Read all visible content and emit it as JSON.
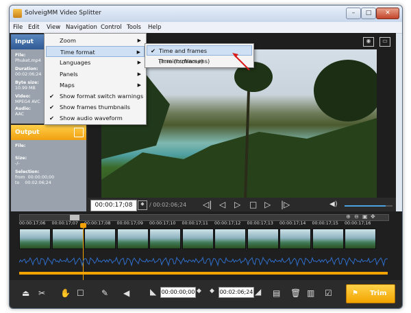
{
  "window": {
    "title": "SolveigMM Video Splitter"
  },
  "menubar": {
    "items": [
      "File",
      "Edit",
      "View",
      "Navigation",
      "Control",
      "Tools",
      "Help"
    ]
  },
  "view_menu": {
    "items": [
      {
        "label": "Zoom",
        "arrow": true,
        "checked": false
      },
      {
        "label": "Time format",
        "arrow": true,
        "checked": false
      },
      {
        "label": "Languages",
        "arrow": true,
        "checked": false
      },
      {
        "label": "Panels",
        "arrow": true,
        "checked": false
      },
      {
        "label": "Maps",
        "arrow": true,
        "checked": false
      },
      {
        "label": "Show format switch warnings",
        "arrow": false,
        "checked": true
      },
      {
        "label": "Show frames thumbnails",
        "arrow": false,
        "checked": true
      },
      {
        "label": "Show audio waveform",
        "arrow": false,
        "checked": true
      }
    ]
  },
  "time_format_submenu": {
    "items": [
      {
        "label": "Time and frames (h:min:s;frame)",
        "checked": true
      },
      {
        "label": "Time (h:min:s,ms)",
        "checked": false
      }
    ]
  },
  "input_panel": {
    "title": "Input",
    "file_label": "File:",
    "file_value": "Phuket.mp4",
    "duration_label": "Duration:",
    "duration_value": "00:02:06;24",
    "bytesize_label": "Byte size:",
    "bytesize_value": "10.99 MB",
    "video_label": "Video:",
    "video_value": "MPEG4 AVC",
    "audio_label": "Audio:",
    "audio_value": "AAC"
  },
  "output_panel": {
    "title": "Output",
    "file_label": "File:",
    "size_label": "Size:",
    "size_value": "-/-",
    "selection_label": "Selection:",
    "from_label": "from",
    "from_value": "00:00:00;00",
    "to_label": "to",
    "to_value": "00:02:06;24"
  },
  "player": {
    "current_time": "00:00:17;08",
    "total_time": "/ 00:02:06;24",
    "volume_level": 0.85
  },
  "timeline": {
    "ticks": [
      "00:00:17;06",
      "00:00:17;07",
      "00:00:17;08",
      "00:00:17;09",
      "00:00:17;10",
      "00:00:17;11",
      "00:00:17;12",
      "00:00:17;13",
      "00:00:17;14",
      "00:00:17;15",
      "00:00:17;16"
    ]
  },
  "bottom": {
    "start_time": "00:00:00;00",
    "end_time": "00:02:06;24",
    "trim_label": "Trim"
  },
  "colors": {
    "accent": "#f2a300",
    "panel_blue": "#3b67a3",
    "highlight": "#cfe0f5"
  }
}
